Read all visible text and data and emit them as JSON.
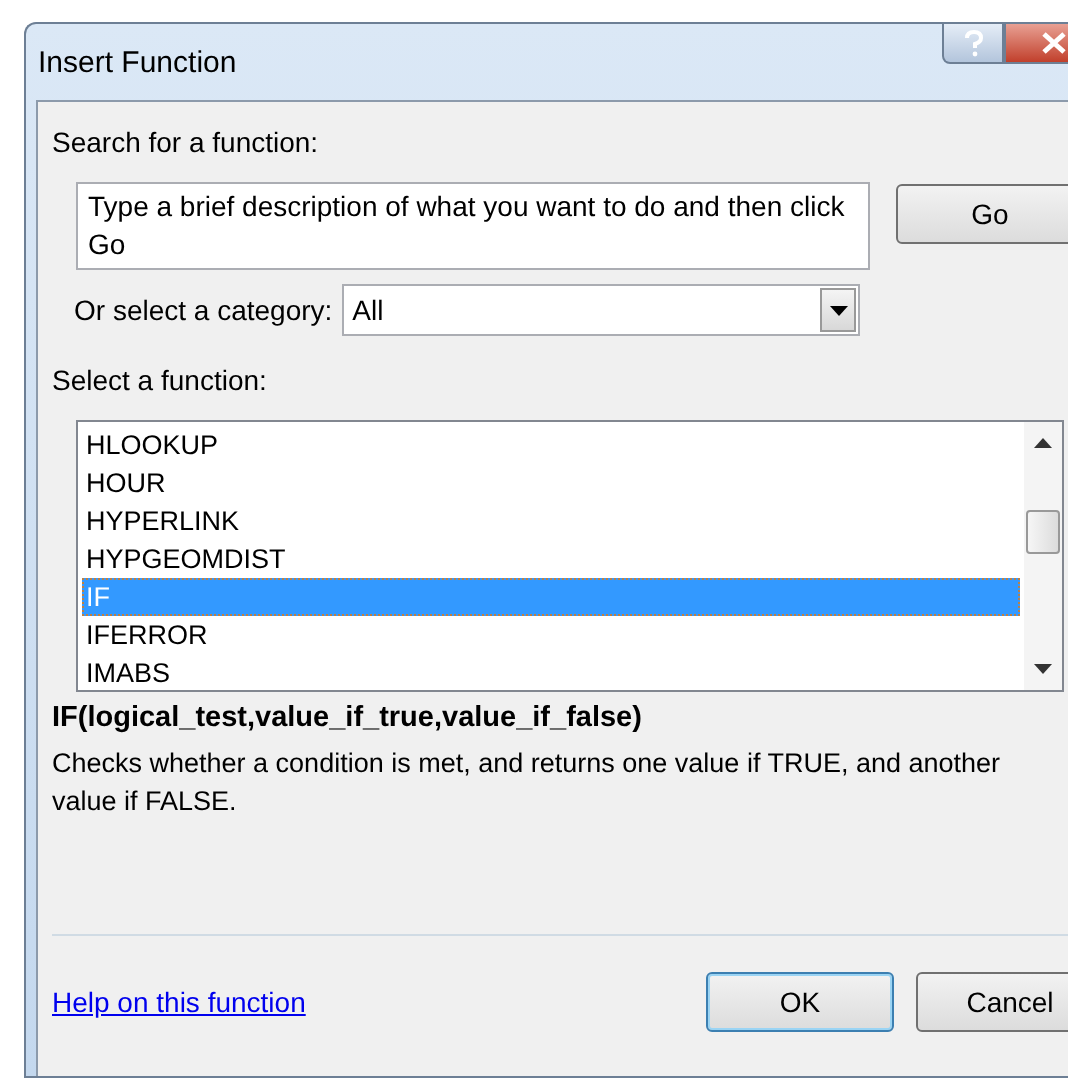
{
  "window": {
    "title": "Insert Function"
  },
  "search": {
    "label": "Search for a function:",
    "value": "Type a brief description of what you want to do and then click Go",
    "button": "Go"
  },
  "category": {
    "label": "Or select a category:",
    "value": "All"
  },
  "functions": {
    "label": "Select a function:",
    "items": [
      {
        "name": "HLOOKUP",
        "selected": false
      },
      {
        "name": "HOUR",
        "selected": false
      },
      {
        "name": "HYPERLINK",
        "selected": false
      },
      {
        "name": "HYPGEOMDIST",
        "selected": false
      },
      {
        "name": "IF",
        "selected": true
      },
      {
        "name": "IFERROR",
        "selected": false
      },
      {
        "name": "IMABS",
        "selected": false
      }
    ]
  },
  "signature": "IF(logical_test,value_if_true,value_if_false)",
  "description": "Checks whether a condition is met, and returns one value if TRUE, and another value if FALSE.",
  "help_link": "Help on this function",
  "buttons": [
    {
      "label": "OK",
      "default": true
    },
    {
      "label": "Cancel",
      "default": false
    }
  ]
}
